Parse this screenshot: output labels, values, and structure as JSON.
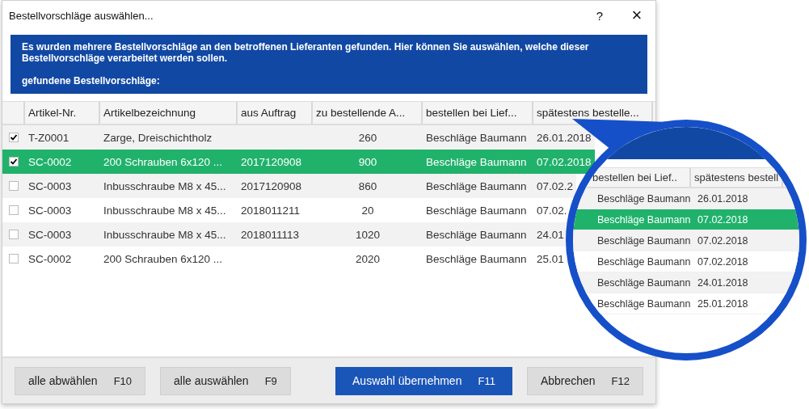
{
  "window": {
    "title": "Bestellvorschläge auswählen...",
    "help": "?",
    "close": "×"
  },
  "banner": {
    "message": "Es wurden mehrere Bestellvorschläge an den betroffenen Lieferanten gefunden. Hier können Sie auswählen, welche dieser Bestellvorschläge verarbeitet werden sollen.",
    "caption": "gefundene Bestellvorschläge:"
  },
  "table": {
    "columns": [
      "Artikel-Nr.",
      "Artikelbezeichnung",
      "aus Auftrag",
      "zu bestellende A...",
      "bestellen bei Lief...",
      "spätestens bestelle..."
    ],
    "rows": [
      {
        "checked": true,
        "selected": false,
        "article_no": "T-Z0001",
        "description": "Zarge, Dreischichtholz",
        "quantity": "260",
        "supplier": "Beschläge Baumann",
        "date": "26.01.2018"
      },
      {
        "checked": true,
        "selected": true,
        "article_no": "SC-0002",
        "description": "200 Schrauben 6x120 ...",
        "order": "2017120908",
        "quantity": "900",
        "supplier": "Beschläge Baumann",
        "date": "07.02.2018"
      },
      {
        "checked": false,
        "selected": false,
        "article_no": "SC-0003",
        "description": "Inbusschraube M8 x 45...",
        "order": "2017120908",
        "quantity": "860",
        "supplier": "Beschläge Baumann",
        "date": "07.02.2"
      },
      {
        "checked": false,
        "selected": false,
        "article_no": "SC-0003",
        "description": "Inbusschraube M8 x 45...",
        "order": "2018011211",
        "quantity": "20",
        "supplier": "Beschläge Baumann",
        "date": "07.02."
      },
      {
        "checked": false,
        "selected": false,
        "article_no": "SC-0003",
        "description": "Inbusschraube M8 x 45...",
        "order": "2018011113",
        "quantity": "1020",
        "supplier": "Beschläge Baumann",
        "date": "24.01"
      },
      {
        "checked": false,
        "selected": false,
        "article_no": "SC-0002",
        "description": "200 Schrauben 6x120 ...",
        "quantity": "2020",
        "supplier": "Beschläge Baumann",
        "date": "25.01"
      }
    ]
  },
  "buttons": [
    {
      "label": "alle abwählen",
      "shortcut": "F10",
      "primary": false
    },
    {
      "label": "alle auswählen",
      "shortcut": "F9",
      "primary": false
    },
    {
      "label": "Auswahl übernehmen",
      "shortcut": "F11",
      "primary": true
    },
    {
      "label": "Abbrechen",
      "shortcut": "F12",
      "primary": false
    }
  ],
  "magnifier": {
    "columns": [
      "bestellen bei Lief..",
      "spätestens bestell"
    ],
    "rows": [
      {
        "supplier": "Beschläge Baumann",
        "date": "26.01.2018",
        "selected": false
      },
      {
        "supplier": "Beschläge Baumann",
        "date": "07.02.2018",
        "selected": true
      },
      {
        "supplier": "Beschläge Baumann",
        "date": "07.02.2018",
        "selected": false
      },
      {
        "supplier": "Beschläge Baumann",
        "date": "07.02.2018",
        "selected": false
      },
      {
        "supplier": "Beschläge Baumann",
        "date": "24.01.2018",
        "selected": false
      },
      {
        "supplier": "Beschläge Baumann",
        "date": "25.01.2018",
        "selected": false
      }
    ]
  }
}
